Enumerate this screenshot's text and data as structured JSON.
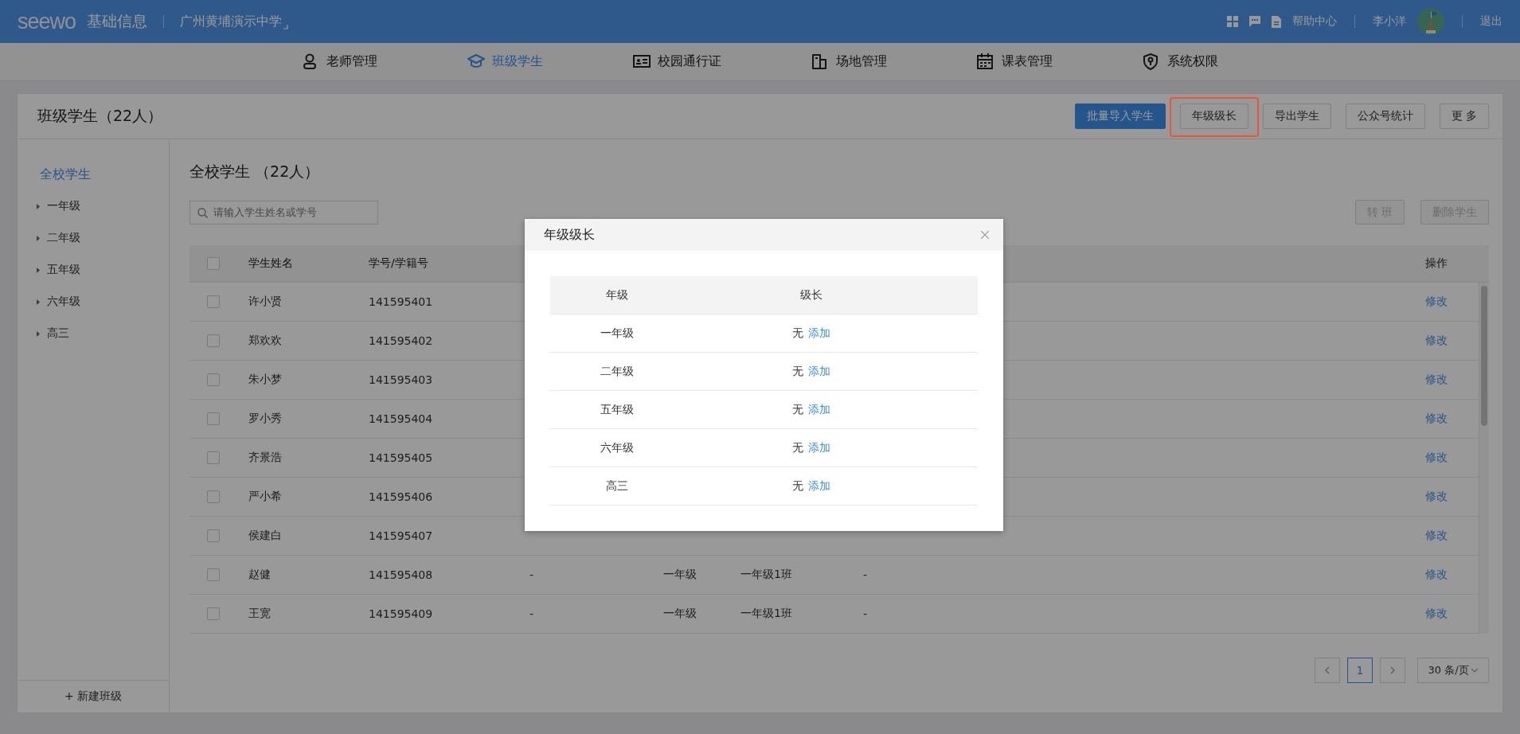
{
  "top_bar": {
    "logo": "seewo",
    "app_name": "基础信息",
    "school": "广州黄埔演示中学",
    "help": "帮助中心",
    "user": "李小洋",
    "logout": "退出"
  },
  "nav": [
    {
      "label": "老师管理",
      "kind": "person",
      "selected": false
    },
    {
      "label": "班级学生",
      "kind": "cap",
      "selected": true
    },
    {
      "label": "校园通行证",
      "kind": "card",
      "selected": false
    },
    {
      "label": "场地管理",
      "kind": "building",
      "selected": false
    },
    {
      "label": "课表管理",
      "kind": "calendar",
      "selected": false
    },
    {
      "label": "系统权限",
      "kind": "shield",
      "selected": false
    }
  ],
  "page": {
    "title": "班级学生（22人）",
    "buttons": [
      {
        "label": "批量导入学生",
        "primary": true,
        "highlighted": false
      },
      {
        "label": "年级级长",
        "primary": false,
        "highlighted": true
      },
      {
        "label": "导出学生",
        "primary": false,
        "highlighted": false
      },
      {
        "label": "公众号统计",
        "primary": false,
        "highlighted": false
      },
      {
        "label": "更 多",
        "primary": false,
        "highlighted": false
      }
    ]
  },
  "sidebar": {
    "items": [
      {
        "label": "全校学生",
        "selected": true,
        "expandable": false
      },
      {
        "label": "一年级",
        "selected": false,
        "expandable": true
      },
      {
        "label": "二年级",
        "selected": false,
        "expandable": true
      },
      {
        "label": "五年级",
        "selected": false,
        "expandable": true
      },
      {
        "label": "六年级",
        "selected": false,
        "expandable": true
      },
      {
        "label": "高三",
        "selected": false,
        "expandable": true
      }
    ],
    "footer": "+ 新建班级"
  },
  "main": {
    "title": "全校学生 （22人）",
    "search": {
      "placeholder": "请输入学生姓名或学号"
    },
    "actions": [
      {
        "label": "转 班",
        "disabled": true
      },
      {
        "label": "删除学生",
        "disabled": true
      }
    ],
    "table": {
      "header_checked": false,
      "columns": {
        "name": "学生姓名",
        "number": "学号/学籍号",
        "action": "操作"
      },
      "rows": [
        {
          "checked": false,
          "name": "许小贤",
          "number": "141595401",
          "action": "修改"
        },
        {
          "checked": false,
          "name": "郑欢欢",
          "number": "141595402",
          "action": "修改"
        },
        {
          "checked": false,
          "name": "朱小梦",
          "number": "141595403",
          "action": "修改"
        },
        {
          "checked": false,
          "name": "罗小秀",
          "number": "141595404",
          "action": "修改"
        },
        {
          "checked": false,
          "name": "齐景浩",
          "number": "141595405",
          "action": "修改"
        },
        {
          "checked": false,
          "name": "严小希",
          "number": "141595406",
          "action": "修改"
        },
        {
          "checked": false,
          "name": "侯建白",
          "number": "141595407",
          "action": "修改"
        },
        {
          "checked": false,
          "name": "赵健",
          "number": "141595408",
          "column_3": "-",
          "column_4": "一年级",
          "column_5": "一年级1班",
          "column_6": "-",
          "action": "修改"
        },
        {
          "checked": false,
          "name": "王宽",
          "number": "141595409",
          "column_3": "-",
          "column_4": "一年级",
          "column_5": "一年级1班",
          "column_6": "-",
          "action": "修改"
        }
      ]
    },
    "pagination": {
      "pages": [
        {
          "label": "1",
          "selected": true
        }
      ],
      "page_size": "30 条/页"
    }
  },
  "modal": {
    "title": "年级级长",
    "columns": [
      "年级",
      "级长"
    ],
    "rows": [
      {
        "grade": "一年级",
        "leader": "无",
        "action": "添加"
      },
      {
        "grade": "二年级",
        "leader": "无",
        "action": "添加"
      },
      {
        "grade": "五年级",
        "leader": "无",
        "action": "添加"
      },
      {
        "grade": "六年级",
        "leader": "无",
        "action": "添加"
      },
      {
        "grade": "高三",
        "leader": "无",
        "action": "添加"
      }
    ]
  }
}
